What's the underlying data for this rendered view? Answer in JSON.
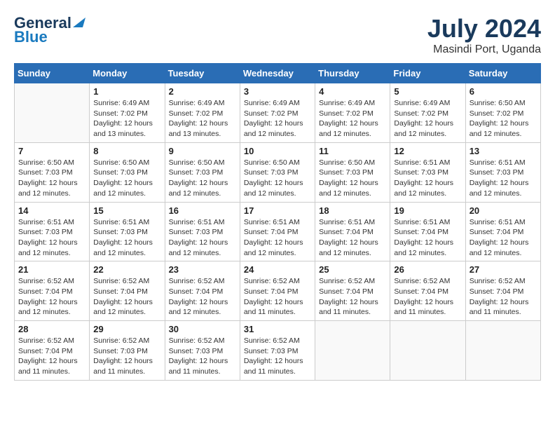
{
  "logo": {
    "general": "General",
    "blue": "Blue"
  },
  "title": {
    "month_year": "July 2024",
    "location": "Masindi Port, Uganda"
  },
  "days_of_week": [
    "Sunday",
    "Monday",
    "Tuesday",
    "Wednesday",
    "Thursday",
    "Friday",
    "Saturday"
  ],
  "weeks": [
    [
      {
        "day": "",
        "info": ""
      },
      {
        "day": "1",
        "info": "Sunrise: 6:49 AM\nSunset: 7:02 PM\nDaylight: 12 hours\nand 13 minutes."
      },
      {
        "day": "2",
        "info": "Sunrise: 6:49 AM\nSunset: 7:02 PM\nDaylight: 12 hours\nand 13 minutes."
      },
      {
        "day": "3",
        "info": "Sunrise: 6:49 AM\nSunset: 7:02 PM\nDaylight: 12 hours\nand 12 minutes."
      },
      {
        "day": "4",
        "info": "Sunrise: 6:49 AM\nSunset: 7:02 PM\nDaylight: 12 hours\nand 12 minutes."
      },
      {
        "day": "5",
        "info": "Sunrise: 6:49 AM\nSunset: 7:02 PM\nDaylight: 12 hours\nand 12 minutes."
      },
      {
        "day": "6",
        "info": "Sunrise: 6:50 AM\nSunset: 7:02 PM\nDaylight: 12 hours\nand 12 minutes."
      }
    ],
    [
      {
        "day": "7",
        "info": "Sunrise: 6:50 AM\nSunset: 7:03 PM\nDaylight: 12 hours\nand 12 minutes."
      },
      {
        "day": "8",
        "info": "Sunrise: 6:50 AM\nSunset: 7:03 PM\nDaylight: 12 hours\nand 12 minutes."
      },
      {
        "day": "9",
        "info": "Sunrise: 6:50 AM\nSunset: 7:03 PM\nDaylight: 12 hours\nand 12 minutes."
      },
      {
        "day": "10",
        "info": "Sunrise: 6:50 AM\nSunset: 7:03 PM\nDaylight: 12 hours\nand 12 minutes."
      },
      {
        "day": "11",
        "info": "Sunrise: 6:50 AM\nSunset: 7:03 PM\nDaylight: 12 hours\nand 12 minutes."
      },
      {
        "day": "12",
        "info": "Sunrise: 6:51 AM\nSunset: 7:03 PM\nDaylight: 12 hours\nand 12 minutes."
      },
      {
        "day": "13",
        "info": "Sunrise: 6:51 AM\nSunset: 7:03 PM\nDaylight: 12 hours\nand 12 minutes."
      }
    ],
    [
      {
        "day": "14",
        "info": "Sunrise: 6:51 AM\nSunset: 7:03 PM\nDaylight: 12 hours\nand 12 minutes."
      },
      {
        "day": "15",
        "info": "Sunrise: 6:51 AM\nSunset: 7:03 PM\nDaylight: 12 hours\nand 12 minutes."
      },
      {
        "day": "16",
        "info": "Sunrise: 6:51 AM\nSunset: 7:03 PM\nDaylight: 12 hours\nand 12 minutes."
      },
      {
        "day": "17",
        "info": "Sunrise: 6:51 AM\nSunset: 7:04 PM\nDaylight: 12 hours\nand 12 minutes."
      },
      {
        "day": "18",
        "info": "Sunrise: 6:51 AM\nSunset: 7:04 PM\nDaylight: 12 hours\nand 12 minutes."
      },
      {
        "day": "19",
        "info": "Sunrise: 6:51 AM\nSunset: 7:04 PM\nDaylight: 12 hours\nand 12 minutes."
      },
      {
        "day": "20",
        "info": "Sunrise: 6:51 AM\nSunset: 7:04 PM\nDaylight: 12 hours\nand 12 minutes."
      }
    ],
    [
      {
        "day": "21",
        "info": "Sunrise: 6:52 AM\nSunset: 7:04 PM\nDaylight: 12 hours\nand 12 minutes."
      },
      {
        "day": "22",
        "info": "Sunrise: 6:52 AM\nSunset: 7:04 PM\nDaylight: 12 hours\nand 12 minutes."
      },
      {
        "day": "23",
        "info": "Sunrise: 6:52 AM\nSunset: 7:04 PM\nDaylight: 12 hours\nand 12 minutes."
      },
      {
        "day": "24",
        "info": "Sunrise: 6:52 AM\nSunset: 7:04 PM\nDaylight: 12 hours\nand 11 minutes."
      },
      {
        "day": "25",
        "info": "Sunrise: 6:52 AM\nSunset: 7:04 PM\nDaylight: 12 hours\nand 11 minutes."
      },
      {
        "day": "26",
        "info": "Sunrise: 6:52 AM\nSunset: 7:04 PM\nDaylight: 12 hours\nand 11 minutes."
      },
      {
        "day": "27",
        "info": "Sunrise: 6:52 AM\nSunset: 7:04 PM\nDaylight: 12 hours\nand 11 minutes."
      }
    ],
    [
      {
        "day": "28",
        "info": "Sunrise: 6:52 AM\nSunset: 7:04 PM\nDaylight: 12 hours\nand 11 minutes."
      },
      {
        "day": "29",
        "info": "Sunrise: 6:52 AM\nSunset: 7:03 PM\nDaylight: 12 hours\nand 11 minutes."
      },
      {
        "day": "30",
        "info": "Sunrise: 6:52 AM\nSunset: 7:03 PM\nDaylight: 12 hours\nand 11 minutes."
      },
      {
        "day": "31",
        "info": "Sunrise: 6:52 AM\nSunset: 7:03 PM\nDaylight: 12 hours\nand 11 minutes."
      },
      {
        "day": "",
        "info": ""
      },
      {
        "day": "",
        "info": ""
      },
      {
        "day": "",
        "info": ""
      }
    ]
  ]
}
